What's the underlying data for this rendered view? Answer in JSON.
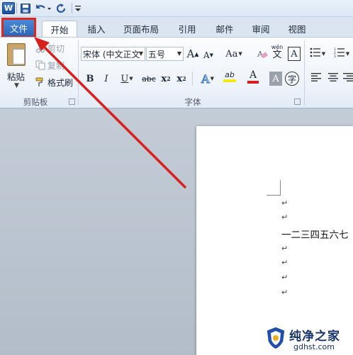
{
  "quick_access": {
    "app_icon": "word-icon",
    "app_icon_letter": "W",
    "items": [
      "save-icon",
      "undo-icon",
      "redo-icon",
      "customize-icon"
    ]
  },
  "tabs": [
    {
      "label": "文件",
      "state": "highlighted"
    },
    {
      "label": "开始",
      "state": "active"
    },
    {
      "label": "插入"
    },
    {
      "label": "页面布局"
    },
    {
      "label": "引用"
    },
    {
      "label": "邮件"
    },
    {
      "label": "审阅"
    },
    {
      "label": "视图"
    }
  ],
  "clipboard": {
    "paste_label": "粘贴",
    "cut_label": "剪切",
    "copy_label": "复制",
    "format_painter_label": "格式刷",
    "group_label": "剪贴板"
  },
  "font": {
    "font_name": "宋体 (中文正文",
    "font_size": "五号",
    "grow_font": "A",
    "shrink_font": "A",
    "change_case": "Aa",
    "clear_format": "A",
    "phonetic": "wén",
    "phonetic_char": "文",
    "char_border": "A",
    "bold": "B",
    "italic": "I",
    "underline": "U",
    "strikethrough": "abc",
    "subscript": "x",
    "subscript_mark": "2",
    "superscript": "x",
    "superscript_mark": "2",
    "text_effect": "A",
    "highlight": "ab",
    "font_color": "A",
    "char_shading": "A",
    "enclose_char": "字",
    "group_label": "字体",
    "colors": {
      "highlight": "#f5e915",
      "font_color": "#d81e1e",
      "file_tab": "#2a65b8",
      "annotation": "#d8211c"
    }
  },
  "document": {
    "para_mark": "↵",
    "text_line": "一二三四五六七"
  },
  "watermark": {
    "title": "纯净之家",
    "url": "gdhst.com"
  }
}
